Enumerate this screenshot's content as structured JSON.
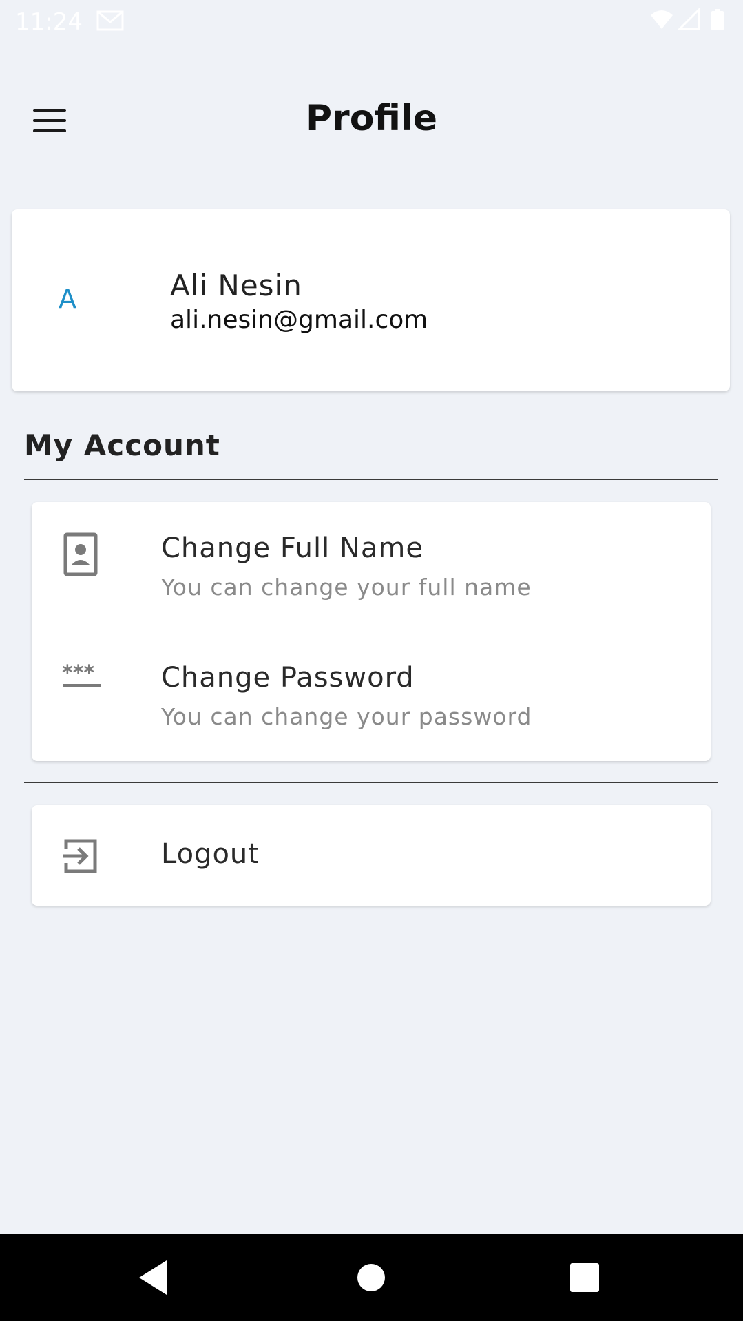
{
  "status_bar": {
    "time": "11:24"
  },
  "app_bar": {
    "title": "Profile",
    "menu_icon": "hamburger-menu-icon"
  },
  "profile": {
    "avatar_letter": "A",
    "name": "Ali Nesin",
    "email": "ali.nesin@gmail.com"
  },
  "my_account": {
    "heading": "My Account",
    "items": [
      {
        "icon": "contact-card-icon",
        "title": "Change Full Name",
        "subtitle": "You can change your full name"
      },
      {
        "icon": "password-icon",
        "title": "Change Password",
        "subtitle": "You can change your password"
      }
    ]
  },
  "logout": {
    "icon": "logout-icon",
    "label": "Logout"
  },
  "nav": {
    "back_icon": "back-triangle-icon",
    "home_icon": "home-circle-icon",
    "recents_icon": "recents-square-icon"
  },
  "colors": {
    "background": "#eff2f7",
    "accent": "#1e8fc8",
    "subtitle": "#8a8a8a",
    "icon": "#7a7a7a"
  }
}
